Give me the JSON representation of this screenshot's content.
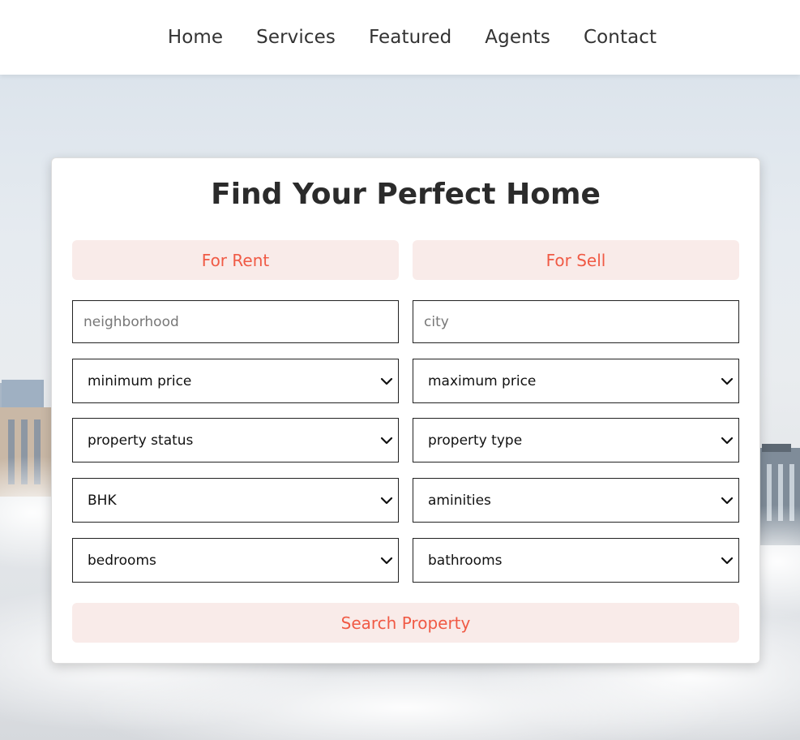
{
  "nav": {
    "items": [
      {
        "label": "Home"
      },
      {
        "label": "Services"
      },
      {
        "label": "Featured"
      },
      {
        "label": "Agents"
      },
      {
        "label": "Contact"
      }
    ]
  },
  "form": {
    "title": "Find Your Perfect Home",
    "tabs": {
      "rent": "For Rent",
      "sell": "For Sell"
    },
    "inputs": {
      "neighborhood_placeholder": "neighborhood",
      "city_placeholder": "city"
    },
    "selects": {
      "min_price": "minimum price",
      "max_price": "maximum price",
      "status": "property status",
      "type": "property type",
      "bhk": "BHK",
      "amenities": "aminities",
      "bedrooms": "bedrooms",
      "bathrooms": "bathrooms"
    },
    "search_label": "Search Property"
  },
  "colors": {
    "accent": "#f05a45",
    "tab_background": "#f9ebe9",
    "text_dark": "#2b2b2b"
  },
  "icons": {
    "select_arrow": "chevron-down-icon"
  }
}
